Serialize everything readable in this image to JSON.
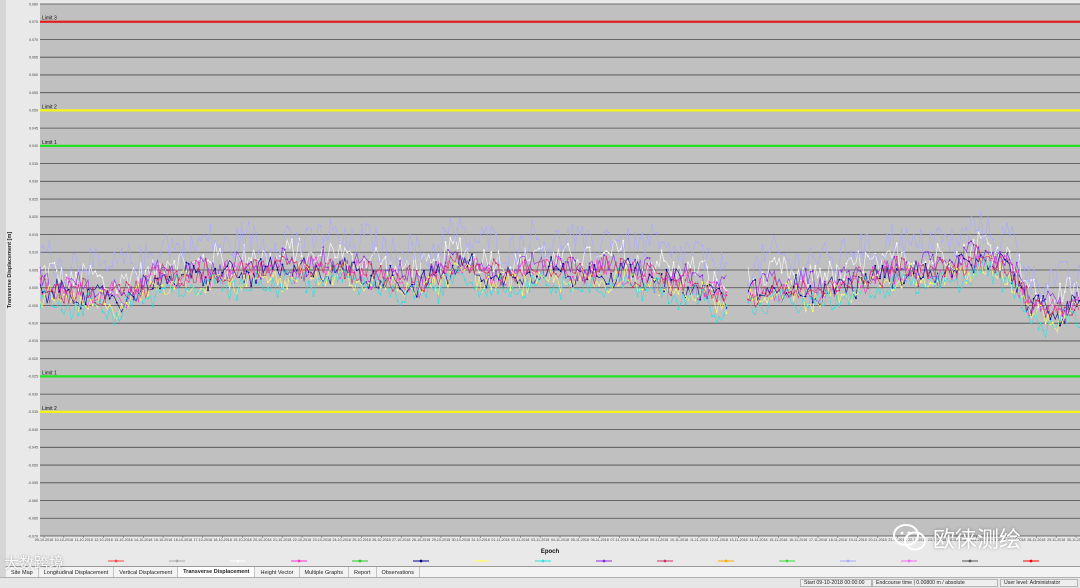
{
  "chart_data": {
    "type": "scatter",
    "title": "",
    "ylabel": "Transverse Displacement [m]",
    "xlabel": "Epoch",
    "ylim": [
      -0.07,
      0.08
    ],
    "grid": true,
    "y_ticks": [
      "0.080",
      "0.075",
      "0.070",
      "0.065",
      "0.060",
      "0.055",
      "0.050",
      "0.045",
      "0.040",
      "0.035",
      "0.030",
      "0.025",
      "0.020",
      "0.015",
      "0.010",
      "0.005",
      "0.000",
      "-0.005",
      "-0.010",
      "-0.015",
      "-0.020",
      "-0.025",
      "-0.030",
      "-0.035",
      "-0.040",
      "-0.045",
      "-0.050",
      "-0.055",
      "-0.060",
      "-0.065",
      "-0.070"
    ],
    "x_ticks": [
      "09-10-2018",
      "10-10-2018",
      "11-10-2018",
      "12-10-2018",
      "13-10-2018",
      "14-10-2018",
      "15-10-2018",
      "16-10-2018",
      "17-10-2018",
      "18-10-2018",
      "19-10-2018",
      "20-10-2018",
      "21-10-2018",
      "22-10-2018",
      "23-10-2018",
      "24-10-2018",
      "25-10-2018",
      "26-10-2018",
      "27-10-2018",
      "28-10-2018",
      "29-10-2018",
      "30-10-2018",
      "31-10-2018",
      "01-11-2018",
      "02-11-2018",
      "03-11-2018",
      "04-11-2018",
      "05-11-2018",
      "06-11-2018",
      "07-11-2018",
      "08-11-2018",
      "09-11-2018",
      "10-11-2018",
      "11-11-2018",
      "12-11-2018",
      "13-11-2018",
      "14-11-2018",
      "15-11-2018",
      "16-11-2018",
      "17-11-2018",
      "18-11-2018",
      "19-11-2018",
      "20-11-2018",
      "21-11-2018",
      "22-11-2018",
      "23-11-2018",
      "24-11-2018",
      "25-11-2018",
      "26-11-2018",
      "27-11-2018",
      "28-11-2018",
      "29-11-2018",
      "30-11-2018"
    ],
    "limits": [
      {
        "label": "Limit 3",
        "value": 0.075,
        "color": "#e02020"
      },
      {
        "label": "Limit 2",
        "value": 0.05,
        "color": "#f5f51a"
      },
      {
        "label": "Limit 1",
        "value": 0.04,
        "color": "#22e022"
      },
      {
        "label": "Limit 1",
        "value": -0.025,
        "color": "#22e022"
      },
      {
        "label": "Limit 2",
        "value": -0.035,
        "color": "#f5f51a"
      }
    ],
    "x_range_days": [
      0,
      52
    ],
    "gaps_days": [
      [
        34.4,
        35.3
      ]
    ],
    "series": [
      {
        "name": "",
        "color": "#ffffff",
        "offset": 0.0035,
        "noise": 0.004
      },
      {
        "name": "",
        "color": "#aaaaff",
        "offset": 0.008,
        "noise": 0.005
      },
      {
        "name": "",
        "color": "#8a2be2",
        "offset": 0.0012,
        "noise": 0.003
      },
      {
        "name": "",
        "color": "#ff33cc",
        "offset": -0.0004,
        "noise": 0.003
      },
      {
        "name": "",
        "color": "#00008b",
        "offset": -0.0008,
        "noise": 0.003
      },
      {
        "name": "",
        "color": "#ffff66",
        "offset": -0.0025,
        "noise": 0.003
      },
      {
        "name": "",
        "color": "#33dddd",
        "offset": -0.004,
        "noise": 0.003
      },
      {
        "name": "",
        "color": "#cc3366",
        "offset": 0.0,
        "noise": 0.003
      }
    ],
    "trend_days": [
      0,
      2,
      4,
      6,
      9,
      12,
      15,
      17,
      19,
      21,
      23,
      25,
      27,
      29,
      31,
      33,
      34,
      35.4,
      37,
      39,
      41,
      43,
      45,
      47,
      48.5,
      49.5,
      51,
      52
    ],
    "trend_values": [
      0.0005,
      -0.001,
      -0.0025,
      0.003,
      0.0045,
      0.0055,
      0.006,
      0.0035,
      0.0015,
      0.0075,
      0.003,
      0.006,
      0.0045,
      0.0055,
      0.0025,
      0.001,
      -0.002,
      -0.0015,
      0.0005,
      -0.0005,
      0.0025,
      0.005,
      0.0045,
      0.0085,
      0.006,
      -0.0045,
      -0.0065,
      -0.0035
    ],
    "legend_markers": [
      "#ff4444",
      "#aaaaaa",
      "#ffffff",
      "#ff33cc",
      "#22cc22",
      "#00008b",
      "#ffff66",
      "#33dddd",
      "#8a2be2",
      "#cc3366",
      "#ffaa00",
      "#33dd33",
      "#aaaaff",
      "#ff66ff",
      "#555555",
      "#ff0000"
    ]
  },
  "tabs": [
    {
      "label": "Site Map",
      "active": false
    },
    {
      "label": "Longitudinal Displacement",
      "active": false
    },
    {
      "label": "Vertical Displacement",
      "active": false
    },
    {
      "label": "Transverse Displacement",
      "active": true
    },
    {
      "label": "Height Vector",
      "active": false
    },
    {
      "label": "Multiple Graphs",
      "active": false
    },
    {
      "label": "Report",
      "active": false
    },
    {
      "label": "Observations",
      "active": false
    }
  ],
  "status": {
    "start": "Start 09-10-2018 00:00:00",
    "endcourse": "Endcourse time | 0.00800 m / absolute",
    "user": "User level: Administrator"
  },
  "watermark_left": "大数跨境",
  "watermark_right": "欧徕测绘",
  "colors": {
    "plot_background": "#c0c0c0",
    "gridline": "#4a4a4a"
  }
}
